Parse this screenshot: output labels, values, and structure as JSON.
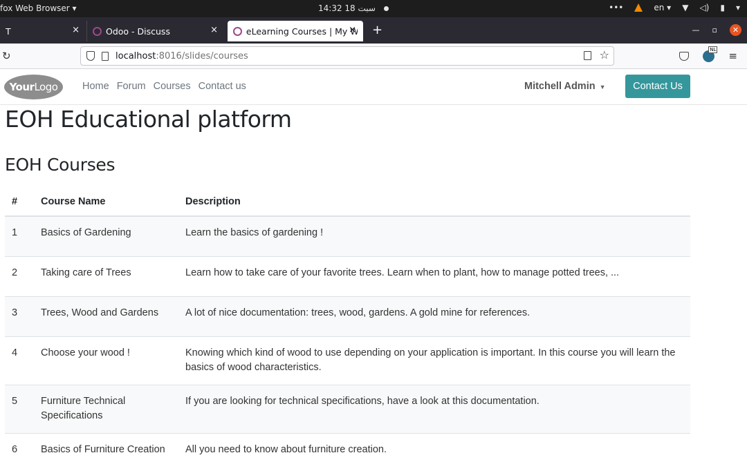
{
  "os_bar": {
    "app_menu": "fox Web Browser ▾",
    "clock": "14:32  18 سبت",
    "language": "en ▾"
  },
  "browser": {
    "tabs": [
      {
        "title": "T"
      },
      {
        "title": "Odoo - Discuss"
      },
      {
        "title": "eLearning Courses | My W"
      }
    ],
    "url_host": "localhost",
    "url_path": ":8016/slides/courses",
    "extension_badge": "NL"
  },
  "site": {
    "logo_bold": "Your",
    "logo_light": "Logo",
    "menu": [
      "Home",
      "Forum",
      "Courses",
      "Contact us"
    ],
    "user_name": "Mitchell Admin",
    "contact_button": "Contact Us"
  },
  "page": {
    "title": "EOH Educational platform",
    "subtitle": "EOH Courses",
    "table": {
      "headers": [
        "#",
        "Course Name",
        "Description"
      ],
      "rows": [
        {
          "num": "1",
          "name": "Basics of Gardening",
          "desc": "Learn the basics of gardening !"
        },
        {
          "num": "2",
          "name": "Taking care of Trees",
          "desc": "Learn how to take care of your favorite trees. Learn when to plant, how to manage potted trees, ..."
        },
        {
          "num": "3",
          "name": "Trees, Wood and Gardens",
          "desc": "A lot of nice documentation: trees, wood, gardens. A gold mine for references."
        },
        {
          "num": "4",
          "name": "Choose your wood !",
          "desc": "Knowing which kind of wood to use depending on your application is important. In this course you will learn the basics of wood characteristics."
        },
        {
          "num": "5",
          "name": "Furniture Technical Specifications",
          "desc": "If you are looking for technical specifications, have a look at this documentation."
        },
        {
          "num": "6",
          "name": "Basics of Furniture Creation",
          "desc": "All you need to know about furniture creation."
        }
      ]
    }
  }
}
